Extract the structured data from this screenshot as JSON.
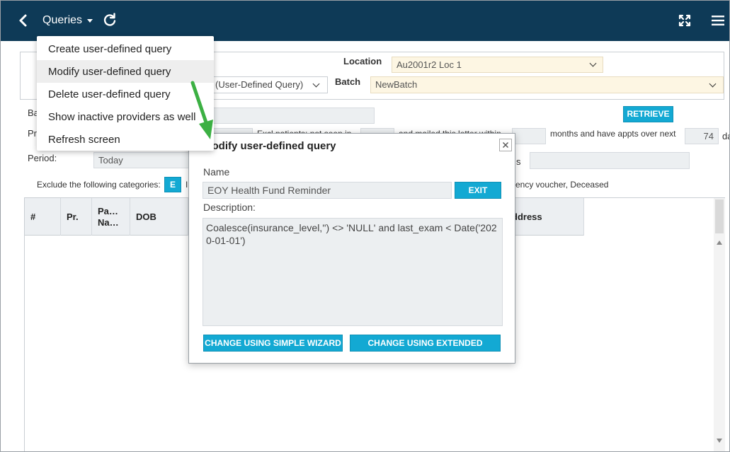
{
  "nav": {
    "title": "Queries"
  },
  "menu": {
    "items": [
      "Create user-defined query",
      "Modify user-defined query",
      "Delete user-defined query",
      "Show inactive providers as well",
      "Refresh screen"
    ],
    "active_index": 1
  },
  "filters": {
    "location_label": "Location",
    "location_value": "Au2001r2 Loc 1",
    "batch_label": "Batch",
    "batch_value": "NewBatch",
    "query_type_value": "(User-Defined Query)",
    "ba_label": "Ba",
    "pr_label": "Pr",
    "excl_text": "Excl patients: not seen in",
    "mailed_text": "and mailed this letter within",
    "months_text": "months and have appts over next",
    "days_value": "74",
    "days_suffix": "da",
    "period_label": "Period:",
    "period_value": "Today",
    "s_label": "s",
    "retrieve_label": "RETRIEVE",
    "exclude_label": "Exclude the following categories:",
    "exclude_btn": "E",
    "exclude_i": "I",
    "exclude_tail": "ency voucher, Deceased"
  },
  "grid": {
    "columns": [
      "#",
      "Pr.",
      "Pa… Na…",
      "DOB",
      "ddress"
    ]
  },
  "modal": {
    "title": "Modify user-defined query",
    "name_label": "Name",
    "name_value": "EOY Health Fund Reminder",
    "exit_label": "EXIT",
    "description_label": "Description:",
    "description_value": "Coalesce(insurance_level,'') <> 'NULL' and last_exam < Date('2020-01-01')",
    "simple_wizard_label": "CHANGE USING SIMPLE WIZARD",
    "extended_wizard_label": "CHANGE USING EXTENDED WIZARD"
  },
  "colors": {
    "topbar": "#0e3a57",
    "accent": "#13a9d3",
    "field_bg": "#eceff1",
    "highlight_field_bg": "#fdf6e3",
    "annotation_arrow": "#3cb043"
  }
}
